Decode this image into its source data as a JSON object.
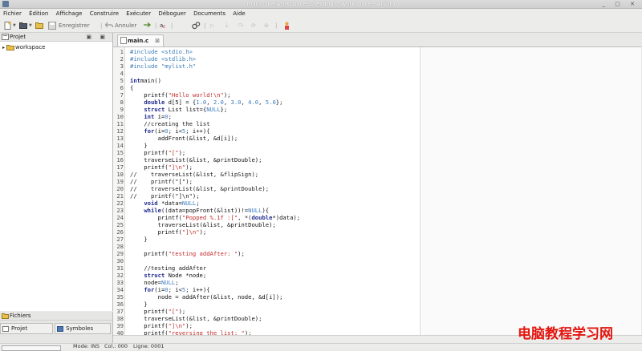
{
  "window": {
    "title": "main.c (~/workspace/C/testing) - workspace - Anjuta"
  },
  "menu": [
    "Fichier",
    "Édition",
    "Affichage",
    "Construire",
    "Exécuter",
    "Déboguer",
    "Documents",
    "Aide"
  ],
  "toolbar": {
    "save_label": "Enregistrer",
    "undo_label": "Annuler"
  },
  "project_panel": {
    "title": "Projet",
    "tree_root": "workspace"
  },
  "files_panel": {
    "title": "Fichiers"
  },
  "bottom_tabs": {
    "project": "Projet",
    "symbols": "Symboles"
  },
  "editor": {
    "tab_label": "main.c"
  },
  "code_lines": [
    "1",
    "2",
    "3",
    "4",
    "5",
    "6",
    "7",
    "8",
    "9",
    "10",
    "11",
    "12",
    "13",
    "14",
    "15",
    "16",
    "17",
    "18",
    "19",
    "20",
    "21",
    "22",
    "23",
    "24",
    "25",
    "26",
    "27",
    "28",
    "29",
    "30",
    "31",
    "32",
    "33",
    "34",
    "35",
    "36",
    "37",
    "38",
    "39",
    "40"
  ],
  "status": {
    "mode": "Mode: INS",
    "col": "Col.: 000",
    "line": "Ligne: 0001",
    "progress": 0
  },
  "watermark": "电脑教程学习网",
  "colors": {
    "keyword": "#1f2a8c",
    "string": "#c22a2a",
    "number": "#3d7ec6",
    "watermark": "#e3160f"
  }
}
